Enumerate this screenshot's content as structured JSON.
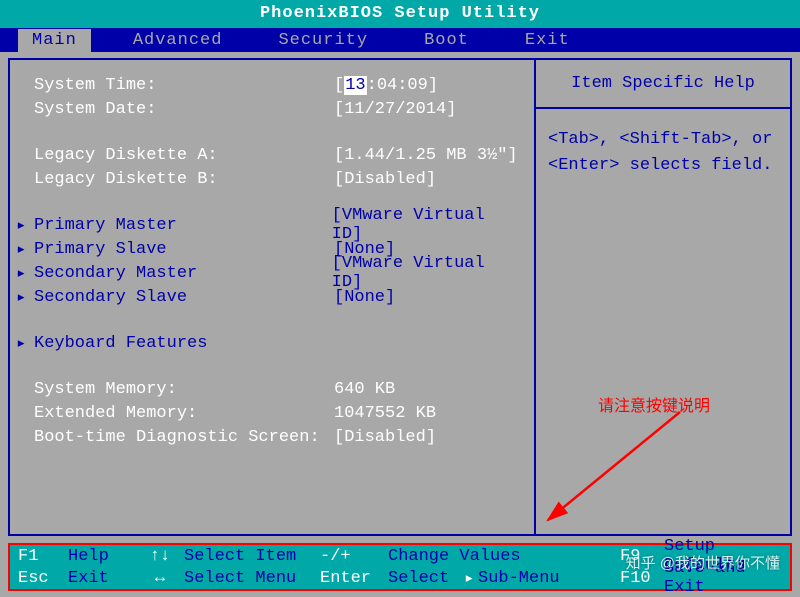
{
  "title": "PhoenixBIOS Setup Utility",
  "menu": {
    "items": [
      "Main",
      "Advanced",
      "Security",
      "Boot",
      "Exit"
    ],
    "active": "Main"
  },
  "main": {
    "system_time_label": "System Time:",
    "system_time_hh": "13",
    "system_time_mm": "04",
    "system_time_ss": "09",
    "system_date_label": "System Date:",
    "system_date_value": "[11/27/2014]",
    "legacy_a_label": "Legacy Diskette A:",
    "legacy_a_value": "[1.44/1.25 MB  3½\"]",
    "legacy_b_label": "Legacy Diskette B:",
    "legacy_b_value": "[Disabled]",
    "primary_master_label": "Primary Master",
    "primary_master_value": "[VMware Virtual ID]",
    "primary_slave_label": "Primary Slave",
    "primary_slave_value": "[None]",
    "secondary_master_label": "Secondary Master",
    "secondary_master_value": "[VMware Virtual ID]",
    "secondary_slave_label": "Secondary Slave",
    "secondary_slave_value": "[None]",
    "keyboard_features_label": "Keyboard Features",
    "sys_mem_label": "System Memory:",
    "sys_mem_value": "640 KB",
    "ext_mem_label": "Extended Memory:",
    "ext_mem_value": "1047552 KB",
    "boot_diag_label": "Boot-time Diagnostic Screen:",
    "boot_diag_value": "[Disabled]"
  },
  "help": {
    "title": "Item Specific Help",
    "body": "<Tab>, <Shift-Tab>, or <Enter> selects field."
  },
  "footer": {
    "r1": {
      "k1": "F1",
      "l1": "Help",
      "g1": "↑↓",
      "l2": "Select Item",
      "g2": "-/+",
      "l3": "Change Values",
      "k2": "F9",
      "l4": "Setup Defaults"
    },
    "r2": {
      "k1": "Esc",
      "l1": "Exit",
      "g1": "↔",
      "l2": "Select Menu",
      "g2": "Enter",
      "l3": "Select",
      "tri": "▸",
      "l3b": "Sub-Menu",
      "k2": "F10",
      "l4": "Save and Exit"
    }
  },
  "annotation": {
    "text": "请注意按键说明"
  },
  "watermark": "知乎 @我的世界你不懂"
}
